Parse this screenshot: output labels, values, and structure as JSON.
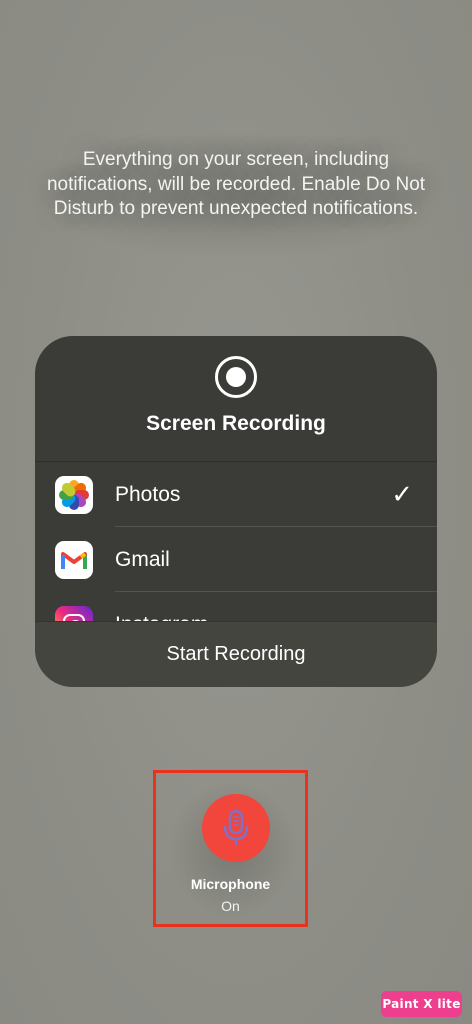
{
  "warning": {
    "text": "Everything on your screen, including notifications, will be recorded. Enable Do Not Disturb to prevent unexpected notifications."
  },
  "panel": {
    "icon": "record-icon",
    "title": "Screen Recording",
    "apps": [
      {
        "label": "Photos",
        "icon": "photos-icon",
        "selected": true
      },
      {
        "label": "Gmail",
        "icon": "gmail-icon",
        "selected": false
      },
      {
        "label": "Instagram",
        "icon": "instagram-icon",
        "selected": false
      }
    ],
    "checkmark": "✓",
    "start_button": "Start Recording"
  },
  "microphone": {
    "icon": "microphone-icon",
    "label": "Microphone",
    "status": "On",
    "color": "#f2453b"
  },
  "watermark": {
    "text": "Paint X lite"
  },
  "colors": {
    "background": "#8f8f88",
    "panel": "#3b3b37",
    "highlight_frame": "#e8321f"
  }
}
